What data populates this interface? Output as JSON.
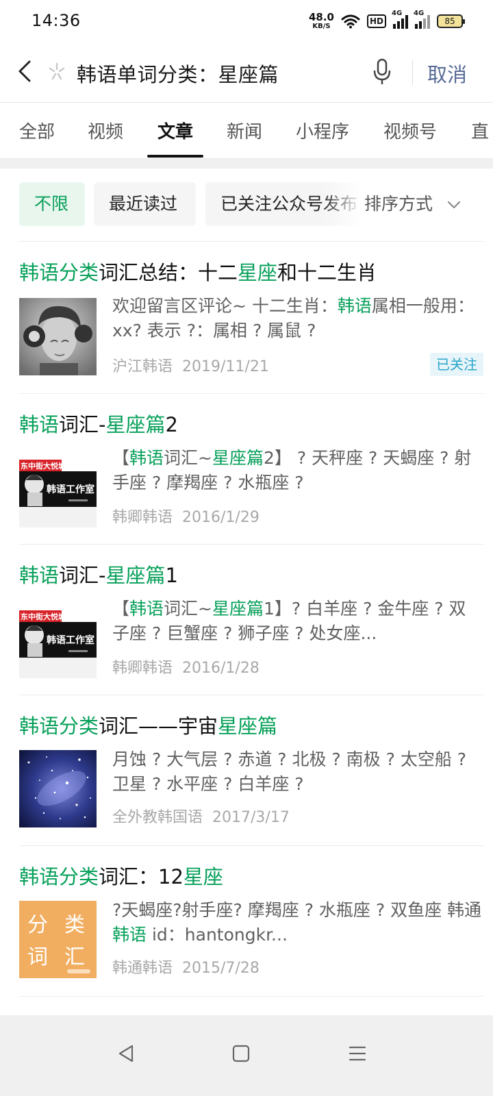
{
  "status_bar": {
    "time": "14:36",
    "net_speed_value": "48.0",
    "net_speed_unit": "KB/S",
    "hd_label": "HD",
    "signal1_label": "4G",
    "signal2_label": "4G",
    "battery": "85"
  },
  "search": {
    "query": "韩语单词分类：星座篇",
    "cancel_label": "取消"
  },
  "tabs": [
    {
      "label": "全部"
    },
    {
      "label": "视频"
    },
    {
      "label": "文章",
      "active": true
    },
    {
      "label": "新闻"
    },
    {
      "label": "小程序"
    },
    {
      "label": "视频号"
    },
    {
      "label": "直"
    }
  ],
  "filters": {
    "chips": [
      {
        "label": "不限",
        "active": true
      },
      {
        "label": "最近读过"
      },
      {
        "label": "已关注公众号发布"
      }
    ],
    "sort_label": "排序方式"
  },
  "results": [
    {
      "title_parts": [
        {
          "text": "韩语分类",
          "hl": true
        },
        {
          "text": "词汇总结：十二"
        },
        {
          "text": "星座",
          "hl": true
        },
        {
          "text": "和十二生肖"
        }
      ],
      "snippet_parts": [
        {
          "text": "欢迎留言区评论~ 十二生肖："
        },
        {
          "text": "韩语",
          "hl": true
        },
        {
          "text": "属相一般用：xx? 表示 ?：属相 ? 属鼠 ?"
        }
      ],
      "source": "沪江韩语",
      "date": "2019/11/21",
      "badge": "已关注",
      "thumb": "portrait-photo"
    },
    {
      "title_parts": [
        {
          "text": "韩语",
          "hl": true
        },
        {
          "text": "词汇-"
        },
        {
          "text": "星座篇",
          "hl": true
        },
        {
          "text": "2"
        }
      ],
      "snippet_parts": [
        {
          "text": "【"
        },
        {
          "text": "韩语",
          "hl": true
        },
        {
          "text": "词汇~"
        },
        {
          "text": "星座篇",
          "hl": true
        },
        {
          "text": "2】 ? 天秤座 ? 天蝎座 ? 射手座 ? 摩羯座 ? 水瓶座 ?"
        }
      ],
      "source": "韩卿韩语",
      "date": "2016/1/29",
      "thumb": "studio-logo",
      "thumb_text_top": "东中街大悦城",
      "thumb_text_main": "韩语工作室"
    },
    {
      "title_parts": [
        {
          "text": "韩语",
          "hl": true
        },
        {
          "text": "词汇-"
        },
        {
          "text": "星座篇",
          "hl": true
        },
        {
          "text": "1"
        }
      ],
      "snippet_parts": [
        {
          "text": "【"
        },
        {
          "text": "韩语",
          "hl": true
        },
        {
          "text": "词汇~"
        },
        {
          "text": "星座篇",
          "hl": true
        },
        {
          "text": "1】? 白羊座 ? 金牛座 ? 双子座 ? 巨蟹座 ? 狮子座 ? 处女座..."
        }
      ],
      "source": "韩卿韩语",
      "date": "2016/1/28",
      "thumb": "studio-logo",
      "thumb_text_top": "东中街大悦城",
      "thumb_text_main": "韩语工作室"
    },
    {
      "title_parts": [
        {
          "text": "韩语分类",
          "hl": true
        },
        {
          "text": "词汇——宇宙"
        },
        {
          "text": "星座篇",
          "hl": true
        }
      ],
      "snippet_parts": [
        {
          "text": "月蚀 ? 大气层 ? 赤道 ? 北极 ? 南极 ? 太空船 ? 卫星 ? 水平座 ? 白羊座 ?"
        }
      ],
      "source": "全外教韩国语",
      "date": "2017/3/17",
      "thumb": "galaxy"
    },
    {
      "title_parts": [
        {
          "text": "韩语分类",
          "hl": true
        },
        {
          "text": "词汇：12"
        },
        {
          "text": "星座",
          "hl": true
        }
      ],
      "snippet_parts": [
        {
          "text": "?天蝎座?射手座? 摩羯座 ? 水瓶座 ? 双鱼座 韩通"
        },
        {
          "text": "韩语",
          "hl": true
        },
        {
          "text": " id：hantongkr..."
        }
      ],
      "source": "韩通韩语",
      "date": "2015/7/28",
      "thumb": "category-card",
      "thumb_chars": [
        "分",
        "类",
        "词",
        "汇"
      ]
    }
  ],
  "colors": {
    "highlight": "#07a05a",
    "cancel": "#576b95",
    "badge_text": "#2aa5c9"
  }
}
